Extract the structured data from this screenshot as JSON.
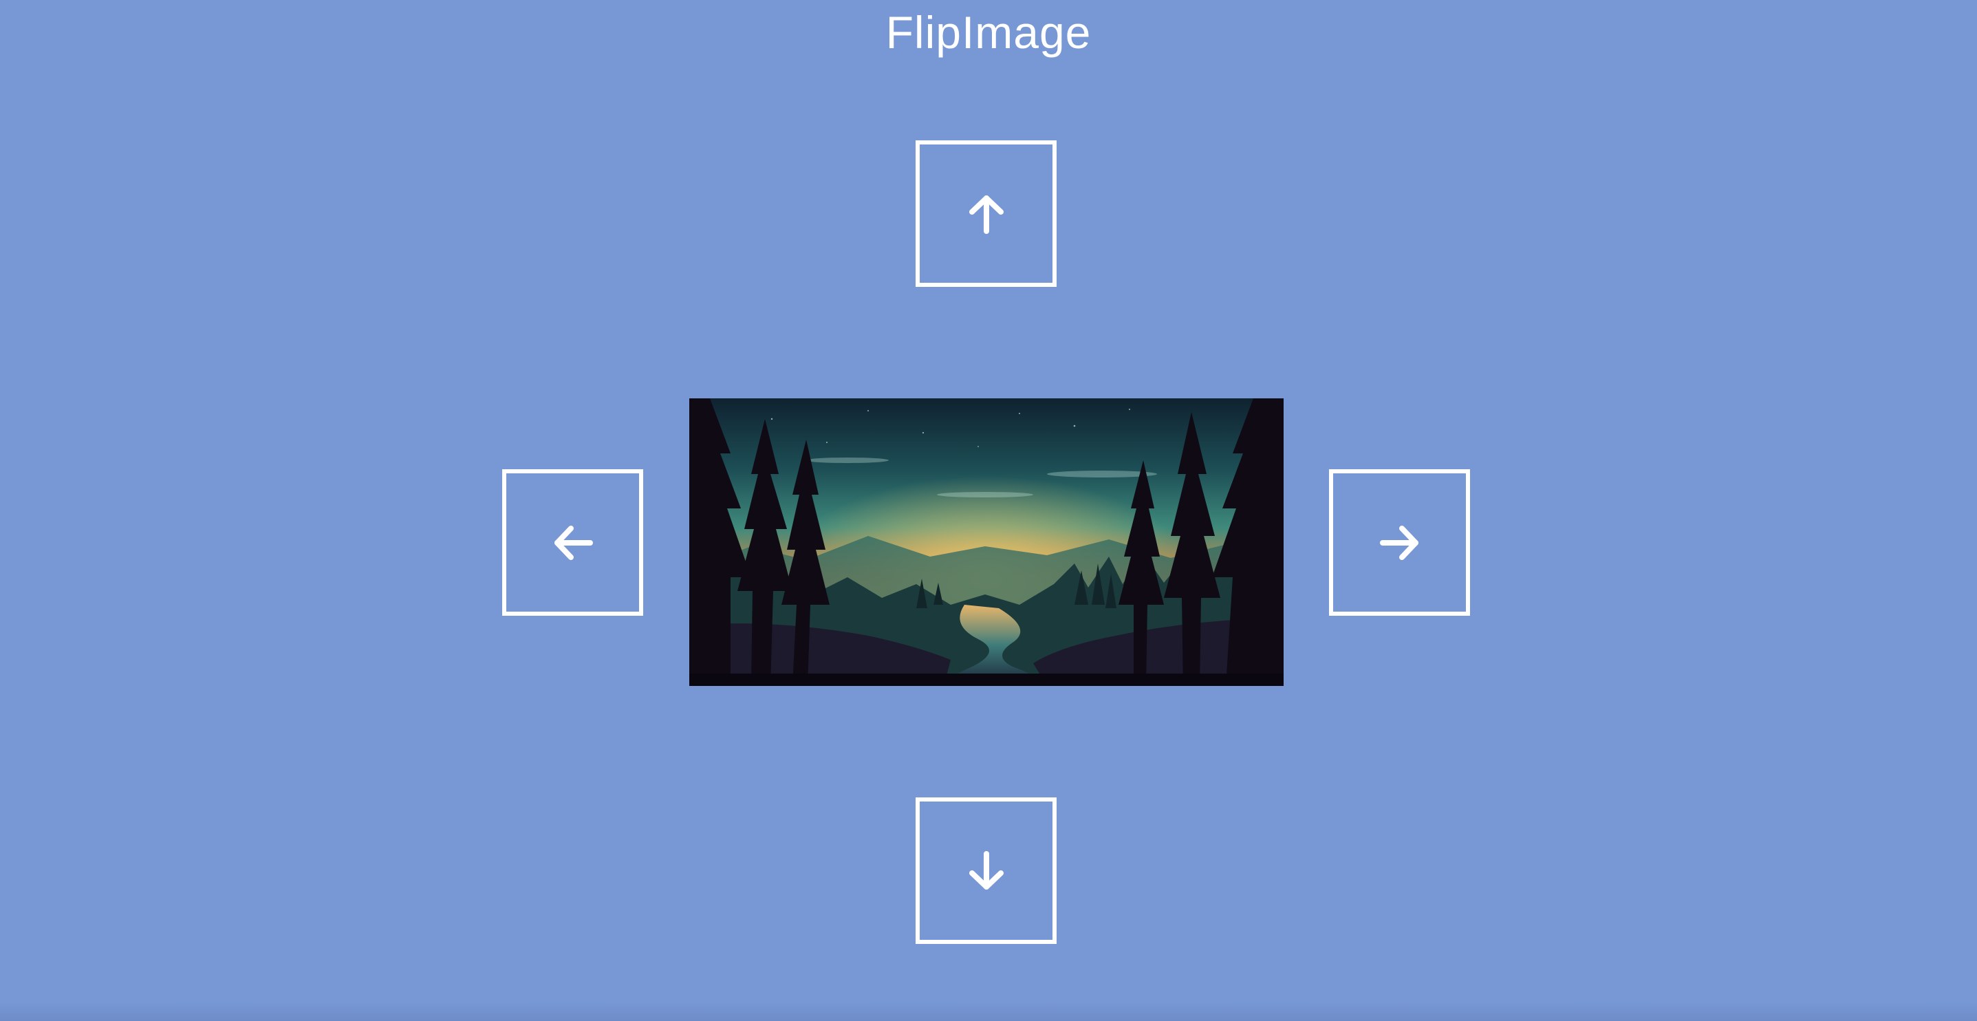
{
  "app": {
    "title": "FlipImage"
  },
  "controls": {
    "up": {
      "icon": "arrow-up-icon"
    },
    "down": {
      "icon": "arrow-down-icon"
    },
    "left": {
      "icon": "arrow-left-icon"
    },
    "right": {
      "icon": "arrow-right-icon"
    }
  },
  "image": {
    "subject": "forest-sunset-landscape-illustration"
  },
  "colors": {
    "background": "#7898d5",
    "foreground": "#ffffff",
    "sky_top": "#142a3a",
    "sky_teal": "#2b7a6e",
    "sunset_glow": "#f0a24a",
    "forest_dark": "#120510"
  }
}
